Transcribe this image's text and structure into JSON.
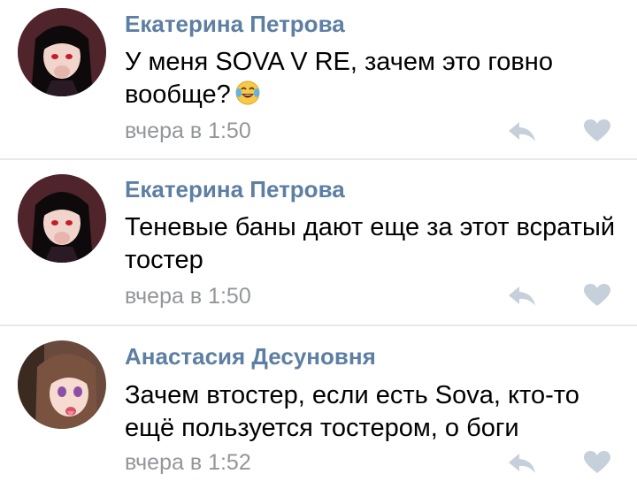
{
  "comments": [
    {
      "author": "Екатерина Петрова",
      "text": "У меня SOVA V RE, зачем это говно вообще?",
      "emoji": "tears-of-joy-emoji",
      "time": "вчера в 1:50",
      "avatar": "dark-hair-girl-avatar"
    },
    {
      "author": "Екатерина Петрова",
      "text": "Теневые баны дают еще за этот всратый тостер",
      "time": "вчера в 1:50",
      "avatar": "dark-hair-girl-avatar"
    },
    {
      "author": "Анастасия Десуновня",
      "text": "Зачем втостер, если есть Sova, кто-то ещё пользуется тостером, о боги",
      "time": "вчера в 1:52",
      "avatar": "brown-hair-girl-avatar"
    }
  ],
  "icons": {
    "reply": "reply-arrow-icon",
    "like": "heart-icon"
  },
  "colors": {
    "author": "#5d7fa3",
    "meta": "#939699",
    "icon": "#c5d0db",
    "divider": "#e7e8ec"
  }
}
